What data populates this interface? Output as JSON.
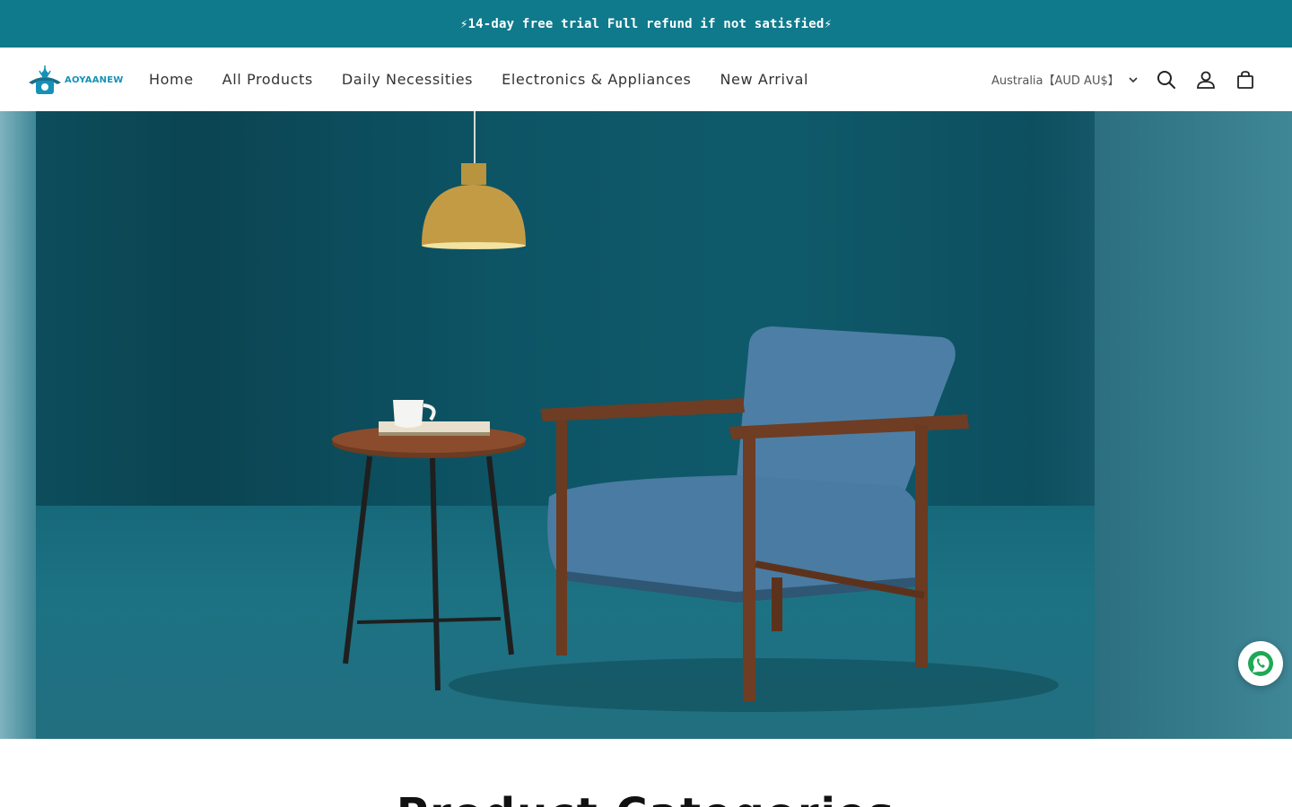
{
  "announcement": {
    "text": "⚡14-day free trial Full refund if not satisfied⚡"
  },
  "header": {
    "logo_text": "AOYAANEW",
    "nav": [
      {
        "label": "Home"
      },
      {
        "label": "All Products"
      },
      {
        "label": "Daily Necessities"
      },
      {
        "label": "Electronics & Appliances"
      },
      {
        "label": "New Arrival"
      }
    ],
    "country_selector": {
      "value": "Australia【AUD AU$】"
    },
    "icons": {
      "search": "search-icon",
      "account": "account-icon",
      "cart": "cart-icon"
    }
  },
  "hero": {
    "image": "armchair-side-table-pendant-lamp"
  },
  "floating": {
    "whatsapp": "whatsapp-icon"
  },
  "section": {
    "title": "Product Categories"
  },
  "colors": {
    "announcement_bg": "#0f7a8c",
    "logo": "#1591b8",
    "hero_bg": "#0d5566"
  }
}
